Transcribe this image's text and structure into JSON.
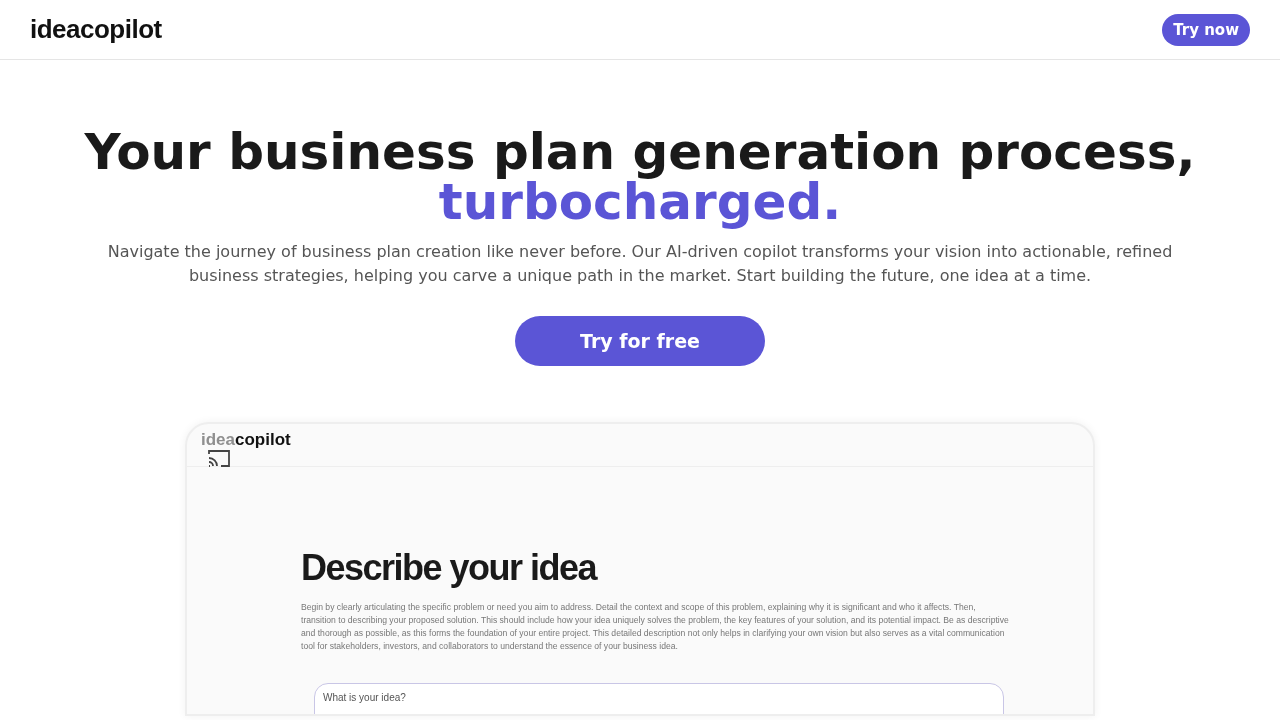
{
  "header": {
    "logo": "ideacopilot",
    "cta": "Try now"
  },
  "hero": {
    "title": "Your business plan generation process,",
    "highlight": "turbocharged.",
    "subtitle": "Navigate the journey of business plan creation like never before. Our AI-driven copilot transforms your vision into actionable, refined business strategies, helping you carve a unique path in the market. Start building the future, one idea at a time.",
    "cta": "Try for free"
  },
  "preview": {
    "logo_faded": "idea",
    "logo": "copilot",
    "heading": "Describe your idea",
    "description": "Begin by clearly articulating the specific problem or need you aim to address. Detail the context and scope of this problem, explaining why it is significant and who it affects. Then, transition to describing your proposed solution. This should include how your idea uniquely solves the problem, the key features of your solution, and its potential impact. Be as descriptive and thorough as possible, as this forms the foundation of your entire project. This detailed description not only helps in clarifying your own vision but also serves as a vital communication tool for stakeholders, investors, and collaborators to understand the essence of your business idea.",
    "input": {
      "placeholder": "What is your idea?"
    }
  }
}
